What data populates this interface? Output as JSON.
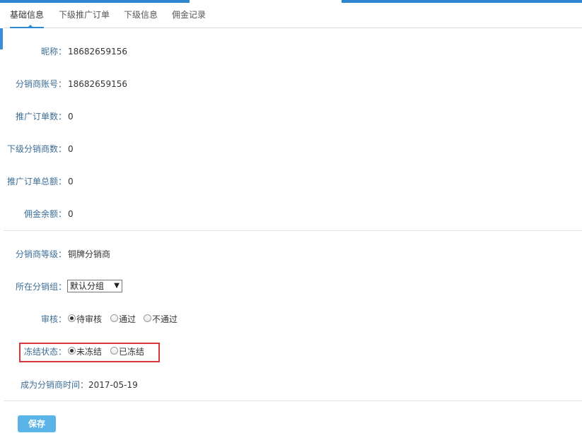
{
  "tabs": [
    {
      "label": "基础信息",
      "active": true
    },
    {
      "label": "下级推广订单",
      "active": false
    },
    {
      "label": "下级信息",
      "active": false
    },
    {
      "label": "佣金记录",
      "active": false
    }
  ],
  "info": {
    "nickname": {
      "label": "昵称：",
      "value": "18682659156"
    },
    "account": {
      "label": "分销商账号：",
      "value": "18682659156"
    },
    "order_count": {
      "label": "推广订单数：",
      "value": "0"
    },
    "sub_count": {
      "label": "下级分销商数：",
      "value": "0"
    },
    "order_total": {
      "label": "推广订单总额：",
      "value": "0"
    },
    "commission": {
      "label": "佣金余额：",
      "value": "0"
    }
  },
  "settings": {
    "level": {
      "label": "分销商等级：",
      "value": "铜牌分销商"
    },
    "group": {
      "label": "所在分销组：",
      "selected": "默认分组"
    },
    "review": {
      "label": "审核：",
      "options": [
        "待审核",
        "通过",
        "不通过"
      ],
      "selected": 0
    },
    "freeze": {
      "label": "冻结状态：",
      "options": [
        "未冻结",
        "已冻结"
      ],
      "selected": 0
    },
    "since": {
      "label": "成为分销商时间：",
      "value": "2017-05-19"
    }
  },
  "save_label": "保存",
  "colors": {
    "accent": "#2d8bd6",
    "label": "#3d6e97",
    "button": "#5ab4e8",
    "highlight": "#d9363e"
  }
}
